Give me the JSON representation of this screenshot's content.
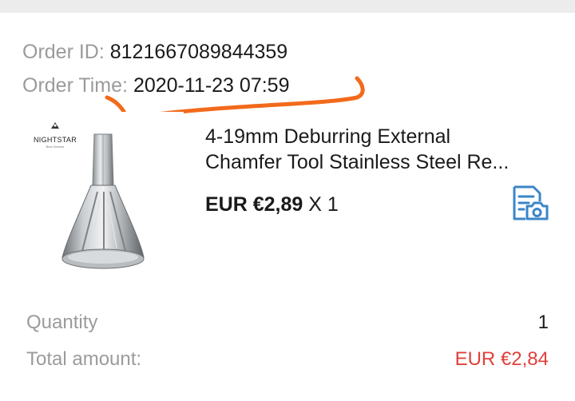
{
  "order": {
    "id_label": "Order ID:",
    "id_value": "8121667089844359",
    "time_label": "Order Time:",
    "time_value": "2020-11-23 07:59"
  },
  "product": {
    "brand": "NIGHTSTAR",
    "brand_sub": "Best Service",
    "title_line1": "4-19mm Deburring External",
    "title_line2": "Chamfer Tool Stainless Steel Re...",
    "price": "EUR €2,89",
    "quantity_text": "X 1",
    "receipt_icon": "receipt-camera-icon"
  },
  "summary": {
    "quantity_label": "Quantity",
    "quantity_value": "1",
    "total_label": "Total amount:",
    "total_value": "EUR €2,84"
  },
  "colors": {
    "accent_blue": "#3a86c8",
    "total_red": "#e0403a",
    "scribble_orange": "#f26a1b",
    "muted_label": "#9b9b9b"
  }
}
